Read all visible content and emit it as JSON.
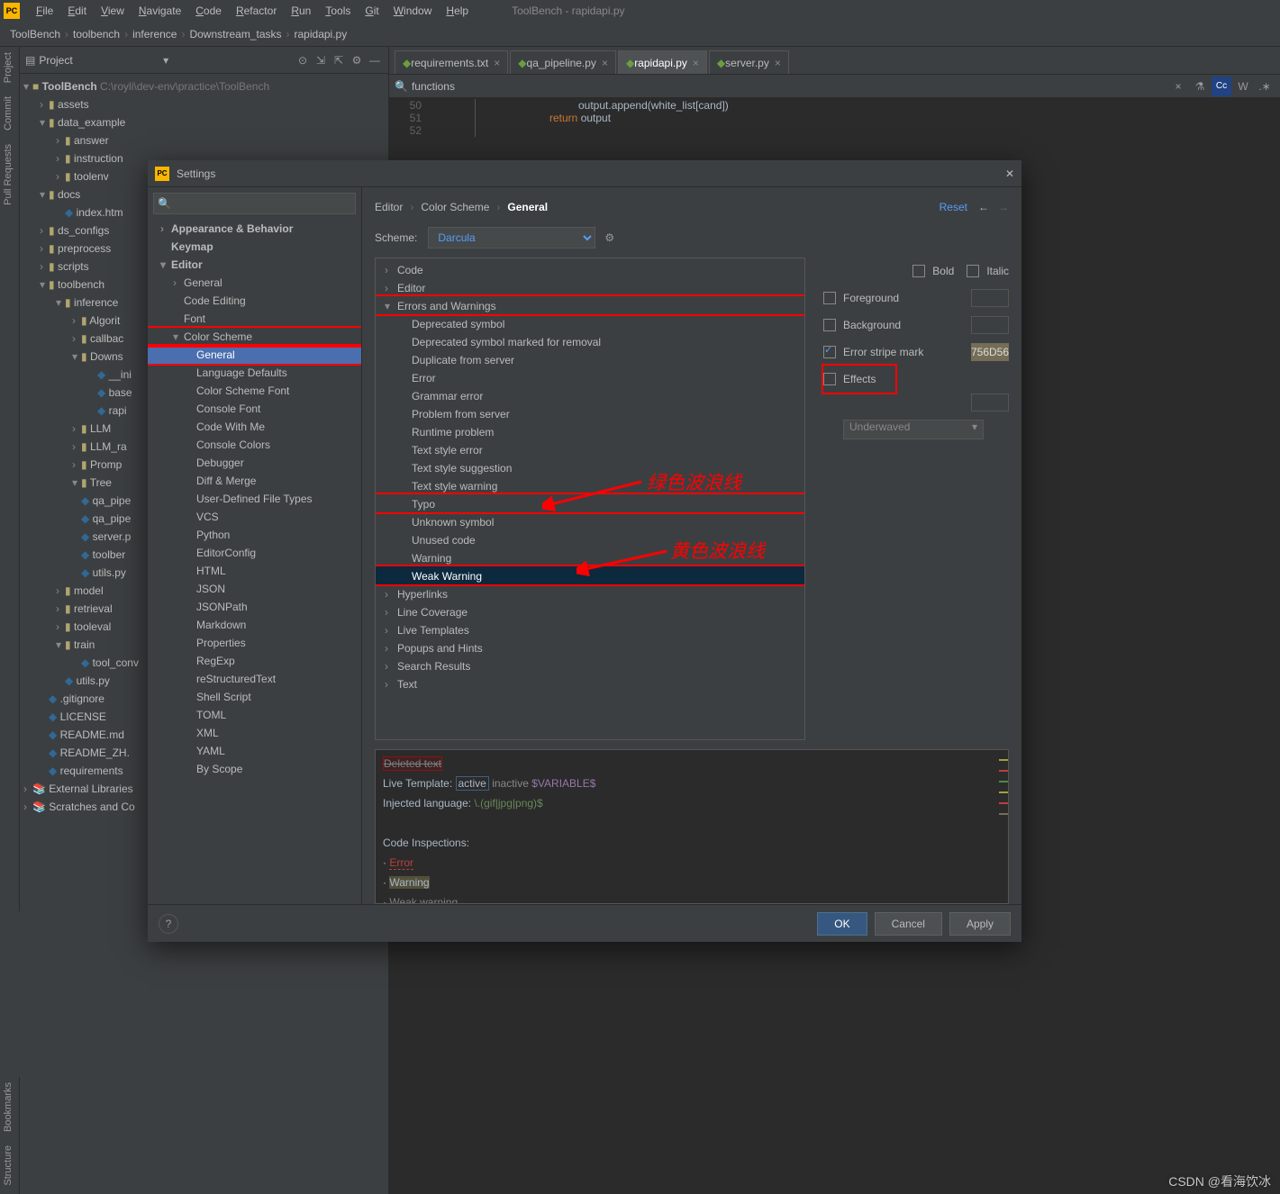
{
  "menubar": {
    "items": [
      "File",
      "Edit",
      "View",
      "Navigate",
      "Code",
      "Refactor",
      "Run",
      "Tools",
      "Git",
      "Window",
      "Help"
    ],
    "title": "ToolBench - rapidapi.py"
  },
  "breadcrumbs": [
    "ToolBench",
    "toolbench",
    "inference",
    "Downstream_tasks",
    "rapidapi.py"
  ],
  "side_tabs": {
    "top": [
      "Project",
      "Commit",
      "Pull Requests"
    ],
    "bottom": [
      "Bookmarks",
      "Structure"
    ]
  },
  "project": {
    "title": "Project",
    "root": {
      "name": "ToolBench",
      "path": "C:\\royli\\dev-env\\practice\\ToolBench"
    },
    "nodes": [
      {
        "d": 1,
        "t": "assets",
        "fld": 1,
        "open": 0
      },
      {
        "d": 1,
        "t": "data_example",
        "fld": 1,
        "open": 1
      },
      {
        "d": 2,
        "t": "answer",
        "fld": 1,
        "open": 0
      },
      {
        "d": 2,
        "t": "instruction",
        "fld": 1,
        "open": 0
      },
      {
        "d": 2,
        "t": "toolenv",
        "fld": 1,
        "open": 0
      },
      {
        "d": 1,
        "t": "docs",
        "fld": 1,
        "open": 1
      },
      {
        "d": 2,
        "t": "index.htm",
        "fic": "htm"
      },
      {
        "d": 1,
        "t": "ds_configs",
        "fld": 1,
        "open": 0
      },
      {
        "d": 1,
        "t": "preprocess",
        "fld": 1,
        "open": 0
      },
      {
        "d": 1,
        "t": "scripts",
        "fld": 1,
        "open": 0
      },
      {
        "d": 1,
        "t": "toolbench",
        "fld": 1,
        "open": 1
      },
      {
        "d": 2,
        "t": "inference",
        "fld": 1,
        "open": 1
      },
      {
        "d": 3,
        "t": "Algorit",
        "fld": 1,
        "open": 0
      },
      {
        "d": 3,
        "t": "callbac",
        "fld": 1,
        "open": 0
      },
      {
        "d": 3,
        "t": "Downs",
        "fld": 1,
        "open": 1
      },
      {
        "d": 4,
        "t": "__ini",
        "fic": "py"
      },
      {
        "d": 4,
        "t": "base",
        "fic": "py"
      },
      {
        "d": 4,
        "t": "rapi",
        "fic": "py"
      },
      {
        "d": 3,
        "t": "LLM",
        "fld": 1,
        "open": 0
      },
      {
        "d": 3,
        "t": "LLM_ra",
        "fld": 1,
        "open": 0
      },
      {
        "d": 3,
        "t": "Promp",
        "fld": 1,
        "open": 0
      },
      {
        "d": 3,
        "t": "Tree",
        "fld": 1,
        "open": 1
      },
      {
        "d": 3,
        "t": "qa_pipe",
        "fic": "py"
      },
      {
        "d": 3,
        "t": "qa_pipe",
        "fic": "py"
      },
      {
        "d": 3,
        "t": "server.p",
        "fic": "py"
      },
      {
        "d": 3,
        "t": "toolber",
        "fic": "py"
      },
      {
        "d": 3,
        "t": "utils.py",
        "fic": "py"
      },
      {
        "d": 2,
        "t": "model",
        "fld": 1,
        "open": 0
      },
      {
        "d": 2,
        "t": "retrieval",
        "fld": 1,
        "open": 0
      },
      {
        "d": 2,
        "t": "tooleval",
        "fld": 1,
        "open": 0
      },
      {
        "d": 2,
        "t": "train",
        "fld": 1,
        "open": 1
      },
      {
        "d": 3,
        "t": "tool_conv",
        "fic": "py"
      },
      {
        "d": 2,
        "t": "utils.py",
        "fic": "py"
      },
      {
        "d": 1,
        "t": ".gitignore",
        "fic": "git"
      },
      {
        "d": 1,
        "t": "LICENSE",
        "fic": "txt"
      },
      {
        "d": 1,
        "t": "README.md",
        "fic": "md"
      },
      {
        "d": 1,
        "t": "README_ZH.",
        "fic": "md"
      },
      {
        "d": 1,
        "t": "requirements",
        "fic": "txt"
      }
    ],
    "extras": [
      "External Libraries",
      "Scratches and Co"
    ]
  },
  "editor": {
    "tabs": [
      {
        "name": "requirements.txt",
        "icon": "txt",
        "active": false
      },
      {
        "name": "qa_pipeline.py",
        "icon": "py",
        "active": false
      },
      {
        "name": "rapidapi.py",
        "icon": "py",
        "active": true
      },
      {
        "name": "server.py",
        "icon": "py",
        "active": false
      }
    ],
    "find_text": "functions",
    "lines": [
      {
        "n": "50",
        "txt": "output.append(white_list[cand])",
        "indent": 3
      },
      {
        "n": "51",
        "txt": "return output",
        "kw": "return",
        "indent": 2
      },
      {
        "n": "52",
        "txt": "",
        "indent": 0
      }
    ]
  },
  "settings": {
    "title": "Settings",
    "nav": [
      {
        "t": "Appearance & Behavior",
        "b": 1,
        "ar": ">"
      },
      {
        "t": "Keymap",
        "b": 1
      },
      {
        "t": "Editor",
        "b": 1,
        "ar": "v"
      },
      {
        "t": "General",
        "sub": 1,
        "ar": ">"
      },
      {
        "t": "Code Editing",
        "sub": 1
      },
      {
        "t": "Font",
        "sub": 1
      },
      {
        "t": "Color Scheme",
        "sub": 1,
        "ar": "v",
        "box": 1
      },
      {
        "t": "General",
        "sub": 2,
        "sel": 1,
        "box": 1
      },
      {
        "t": "Language Defaults",
        "sub": 2
      },
      {
        "t": "Color Scheme Font",
        "sub": 2
      },
      {
        "t": "Console Font",
        "sub": 2
      },
      {
        "t": "Code With Me",
        "sub": 2
      },
      {
        "t": "Console Colors",
        "sub": 2
      },
      {
        "t": "Debugger",
        "sub": 2
      },
      {
        "t": "Diff & Merge",
        "sub": 2
      },
      {
        "t": "User-Defined File Types",
        "sub": 2
      },
      {
        "t": "VCS",
        "sub": 2
      },
      {
        "t": "Python",
        "sub": 2
      },
      {
        "t": "EditorConfig",
        "sub": 2
      },
      {
        "t": "HTML",
        "sub": 2
      },
      {
        "t": "JSON",
        "sub": 2
      },
      {
        "t": "JSONPath",
        "sub": 2
      },
      {
        "t": "Markdown",
        "sub": 2
      },
      {
        "t": "Properties",
        "sub": 2
      },
      {
        "t": "RegExp",
        "sub": 2
      },
      {
        "t": "reStructuredText",
        "sub": 2
      },
      {
        "t": "Shell Script",
        "sub": 2
      },
      {
        "t": "TOML",
        "sub": 2
      },
      {
        "t": "XML",
        "sub": 2
      },
      {
        "t": "YAML",
        "sub": 2
      },
      {
        "t": "By Scope",
        "sub": 2
      }
    ],
    "crumbs": [
      "Editor",
      "Color Scheme",
      "General"
    ],
    "reset": "Reset",
    "scheme_label": "Scheme:",
    "scheme_value": "Darcula",
    "tree": [
      {
        "t": "Code",
        "d": 1,
        "ar": ">"
      },
      {
        "t": "Editor",
        "d": 1,
        "ar": ">"
      },
      {
        "t": "Errors and Warnings",
        "d": 1,
        "ar": "v",
        "box": 1
      },
      {
        "t": "Deprecated symbol",
        "d": 2
      },
      {
        "t": "Deprecated symbol marked for removal",
        "d": 2
      },
      {
        "t": "Duplicate from server",
        "d": 2
      },
      {
        "t": "Error",
        "d": 2
      },
      {
        "t": "Grammar error",
        "d": 2
      },
      {
        "t": "Problem from server",
        "d": 2
      },
      {
        "t": "Runtime problem",
        "d": 2
      },
      {
        "t": "Text style error",
        "d": 2
      },
      {
        "t": "Text style suggestion",
        "d": 2
      },
      {
        "t": "Text style warning",
        "d": 2
      },
      {
        "t": "Typo",
        "d": 2,
        "box": 1
      },
      {
        "t": "Unknown symbol",
        "d": 2
      },
      {
        "t": "Unused code",
        "d": 2
      },
      {
        "t": "Warning",
        "d": 2
      },
      {
        "t": "Weak Warning",
        "d": 2,
        "sel": 1,
        "box": 1
      },
      {
        "t": "Hyperlinks",
        "d": 1,
        "ar": ">"
      },
      {
        "t": "Line Coverage",
        "d": 1,
        "ar": ">"
      },
      {
        "t": "Live Templates",
        "d": 1,
        "ar": ">"
      },
      {
        "t": "Popups and Hints",
        "d": 1,
        "ar": ">"
      },
      {
        "t": "Search Results",
        "d": 1,
        "ar": ">"
      },
      {
        "t": "Text",
        "d": 1,
        "ar": ">"
      }
    ],
    "props": {
      "bold": "Bold",
      "italic": "Italic",
      "foreground": "Foreground",
      "background": "Background",
      "stripe": "Error stripe mark",
      "stripe_color": "756D56",
      "effects": "Effects",
      "effect_type": "Underwaved"
    },
    "preview": {
      "deleted": "Deleted text",
      "live_template": "Live Template:",
      "active": "active",
      "inactive": "inactive",
      "variable": "$VARIABLE$",
      "injected": "Injected language:",
      "regex": "\\.(gif|jpg|png)$",
      "code_insp": "Code Inspections:",
      "error": "Error",
      "warning": "Warning",
      "weak": "Weak warning"
    },
    "footer": {
      "ok": "OK",
      "cancel": "Cancel",
      "apply": "Apply"
    }
  },
  "annotations": {
    "green": "绿色波浪线",
    "yellow": "黄色波浪线"
  },
  "watermark": "CSDN @看海饮冰"
}
